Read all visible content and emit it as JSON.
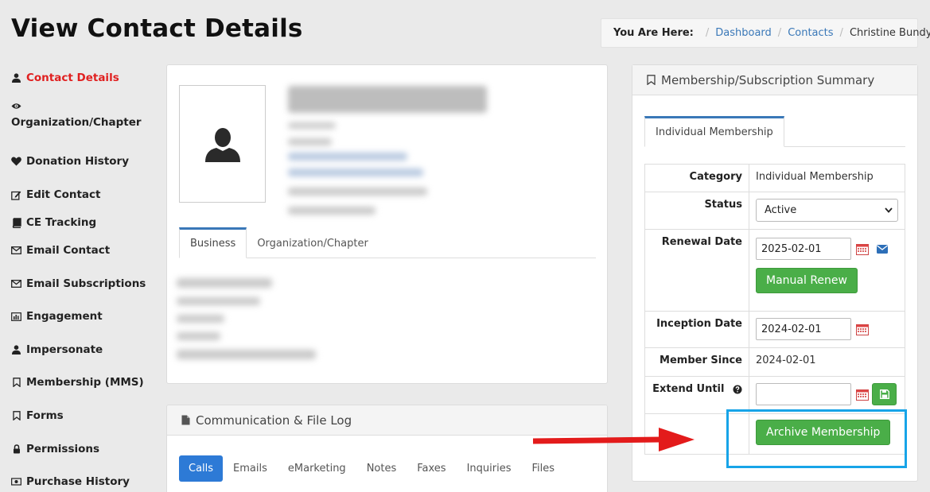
{
  "page": {
    "title": "View Contact Details"
  },
  "breadcrumb": {
    "label": "You Are Here:",
    "items": [
      "Dashboard",
      "Contacts",
      "Christine Bundy"
    ]
  },
  "sidebar": {
    "items": [
      {
        "label": "Contact Details",
        "icon": "user-icon",
        "active": true
      },
      {
        "label": "Organization/Chapter",
        "icon": "eye-icon"
      },
      {
        "label": "Donation History",
        "icon": "heart-icon"
      },
      {
        "label": "Edit Contact",
        "icon": "edit-icon"
      },
      {
        "label": "CE Tracking",
        "icon": "book-icon"
      },
      {
        "label": "Email Contact",
        "icon": "envelope-icon"
      },
      {
        "label": "Email Subscriptions",
        "icon": "envelope-icon"
      },
      {
        "label": "Engagement",
        "icon": "bar-chart-icon"
      },
      {
        "label": "Impersonate",
        "icon": "user-icon"
      },
      {
        "label": "Membership (MMS)",
        "icon": "bookmark-icon"
      },
      {
        "label": "Forms",
        "icon": "bookmark-icon"
      },
      {
        "label": "Permissions",
        "icon": "lock-icon"
      },
      {
        "label": "Purchase History",
        "icon": "money-icon"
      }
    ]
  },
  "contact": {
    "tabs": [
      "Business",
      "Organization/Chapter"
    ]
  },
  "comm_log": {
    "title": "Communication & File Log",
    "tabs": [
      "Calls",
      "Emails",
      "eMarketing",
      "Notes",
      "Faxes",
      "Inquiries",
      "Files"
    ]
  },
  "membership": {
    "title": "Membership/Subscription Summary",
    "tab": "Individual Membership",
    "category_label": "Category",
    "category_value": "Individual Membership",
    "status_label": "Status",
    "status_value": "Active",
    "renewal_label": "Renewal Date",
    "renewal_value": "2025-02-01",
    "manual_renew_label": "Manual Renew",
    "inception_label": "Inception Date",
    "inception_value": "2024-02-01",
    "member_since_label": "Member Since",
    "member_since_value": "2024-02-01",
    "extend_label": "Extend Until",
    "extend_value": "",
    "archive_label": "Archive Membership"
  },
  "colors": {
    "active_link": "#e02020",
    "link": "#3a78b8",
    "primary": "#2d7ad6",
    "success": "#4aae48",
    "highlight": "#17a4e8",
    "arrow": "#e31b1b"
  }
}
